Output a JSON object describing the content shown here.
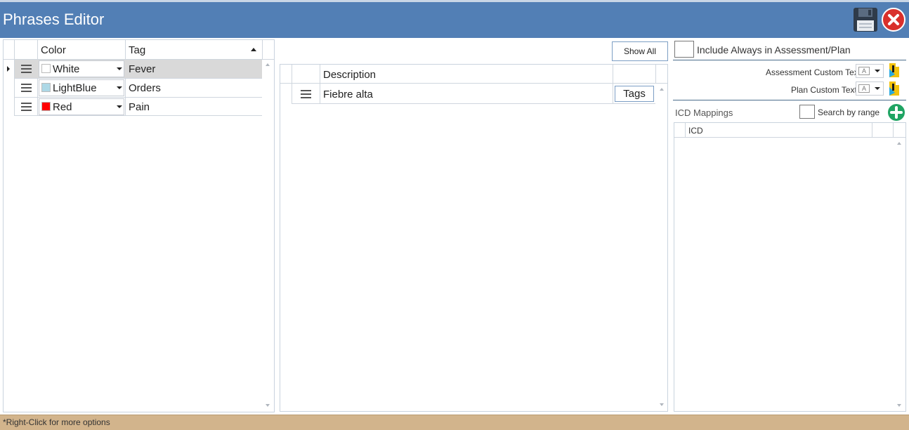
{
  "window": {
    "title": "Phrases Editor",
    "save_icon": "floppy-disk-icon",
    "close_icon": "red-x-close-icon"
  },
  "tags_grid": {
    "headers": {
      "color": "Color",
      "tag": "Tag"
    },
    "rows": [
      {
        "color": "White",
        "swatch": "#ffffff",
        "tag": "Fever"
      },
      {
        "color": "LightBlue",
        "swatch": "#add8e6",
        "tag": "Orders"
      },
      {
        "color": "Red",
        "swatch": "#ff0000",
        "tag": "Pain"
      }
    ]
  },
  "phrases_grid": {
    "show_all_label": "Show All",
    "headers": {
      "description": "Description"
    },
    "rows": [
      {
        "description": "Fiebre alta",
        "tags_label": "Tags"
      }
    ]
  },
  "right_panel": {
    "include_always_label": "Include Always in Assessment/Plan",
    "assessment_custom_text_label": "Assessment Custom Text:",
    "plan_custom_text_label": "Plan Custom Text:",
    "icd_mappings_label": "ICD Mappings",
    "search_by_range_label": "Search by range",
    "icd_header": "ICD"
  },
  "status": {
    "text": "*Right-Click for more options"
  },
  "colors": {
    "titlebar": "#527fb5",
    "statusbar": "#d2b48c",
    "selected_row": "#d9d9d9",
    "add_button": "#1fa463"
  }
}
